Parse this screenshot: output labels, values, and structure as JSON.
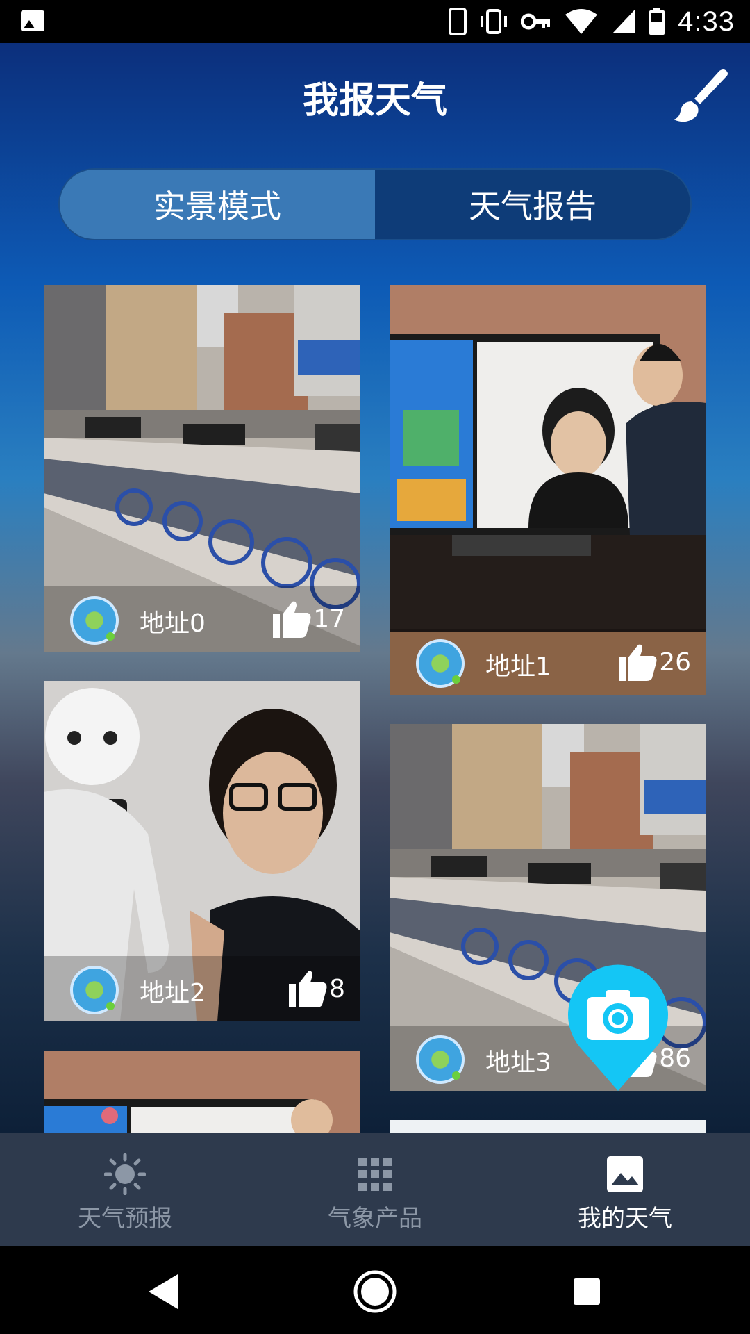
{
  "status_bar": {
    "time": "4:33",
    "battery_level": "39",
    "icons": [
      "gallery-icon",
      "phone-icon",
      "vibrate-icon",
      "key-icon",
      "wifi-icon",
      "signal-icon",
      "battery-icon"
    ]
  },
  "header": {
    "title": "我报天气",
    "edit_icon": "brush-icon"
  },
  "tabs": [
    {
      "label": "实景模式",
      "active": true
    },
    {
      "label": "天气报告",
      "active": false
    }
  ],
  "posts": [
    {
      "address": "地址0",
      "likes": "17"
    },
    {
      "address": "地址1",
      "likes": "26"
    },
    {
      "address": "地址2",
      "likes": "8"
    },
    {
      "address": "地址3",
      "likes": "86"
    }
  ],
  "fab": {
    "icon": "camera-icon"
  },
  "bottom_nav": [
    {
      "label": "天气预报",
      "icon": "sun-icon",
      "active": false
    },
    {
      "label": "气象产品",
      "icon": "grid-icon",
      "active": false
    },
    {
      "label": "我的天气",
      "icon": "image-icon",
      "active": true
    }
  ],
  "colors": {
    "accent_fab": "#14c6f5",
    "nav_bg": "#2e3a4d",
    "tab_active": "#3a79b6"
  }
}
